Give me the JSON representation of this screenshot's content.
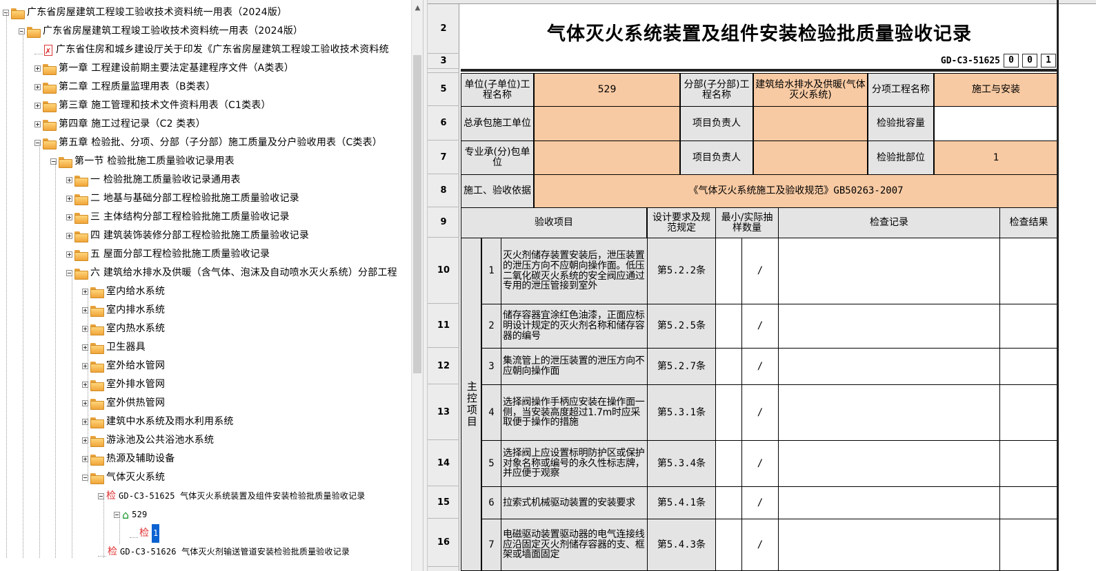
{
  "tree": {
    "nodes": [
      {
        "id": "root",
        "depth": 0,
        "icon": "folder-icon",
        "toggle": "minus",
        "label": "广东省房屋建筑工程竣工验收技术资料统一用表（2024版）"
      },
      {
        "id": "root2",
        "depth": 1,
        "icon": "folder-icon",
        "toggle": "minus",
        "label": "广东省房屋建筑工程竣工验收技术资料统一用表（2024版）"
      },
      {
        "id": "notice",
        "depth": 2,
        "icon": "pdf-icon",
        "toggle": "none",
        "label": "广东省住房和城乡建设厅关于印发《广东省房屋建筑工程竣工验收技术资料统"
      },
      {
        "id": "ch1",
        "depth": 2,
        "icon": "folder-icon",
        "toggle": "plus",
        "label": "第一章 工程建设前期主要法定基建程序文件（A类表）"
      },
      {
        "id": "ch2",
        "depth": 2,
        "icon": "folder-icon",
        "toggle": "plus",
        "label": "第二章 工程质量监理用表（B类表）"
      },
      {
        "id": "ch3",
        "depth": 2,
        "icon": "folder-icon",
        "toggle": "plus",
        "label": "第三章 施工管理和技术文件资料用表（C1类表）"
      },
      {
        "id": "ch4",
        "depth": 2,
        "icon": "folder-icon",
        "toggle": "plus",
        "label": "第四章 施工过程记录（C2 类表）"
      },
      {
        "id": "ch5",
        "depth": 2,
        "icon": "folder-icon",
        "toggle": "minus",
        "label": "第五章 检验批、分项、分部（子分部）施工质量及分户验收用表（C类表）"
      },
      {
        "id": "sec1",
        "depth": 3,
        "icon": "folder-icon",
        "toggle": "minus",
        "label": "第一节 检验批施工质量验收记录用表"
      },
      {
        "id": "s1",
        "depth": 4,
        "icon": "folder-icon",
        "toggle": "plus",
        "label": "一 检验批施工质量验收记录通用表"
      },
      {
        "id": "s2",
        "depth": 4,
        "icon": "folder-icon",
        "toggle": "plus",
        "label": "二 地基与基础分部工程检验批施工质量验收记录"
      },
      {
        "id": "s3",
        "depth": 4,
        "icon": "folder-icon",
        "toggle": "plus",
        "label": "三 主体结构分部工程检验批施工质量验收记录"
      },
      {
        "id": "s4",
        "depth": 4,
        "icon": "folder-icon",
        "toggle": "plus",
        "label": "四 建筑装饰装修分部工程检验批施工质量验收记录"
      },
      {
        "id": "s5",
        "depth": 4,
        "icon": "folder-icon",
        "toggle": "plus",
        "label": "五 屋面分部工程检验批施工质量验收记录"
      },
      {
        "id": "s6",
        "depth": 4,
        "icon": "folder-icon",
        "toggle": "minus",
        "label": "六 建筑给水排水及供暖（含气体、泡沫及自动喷水灭火系统）分部工程"
      },
      {
        "id": "s6a",
        "depth": 5,
        "icon": "folder-icon",
        "toggle": "plus",
        "label": "室内给水系统"
      },
      {
        "id": "s6b",
        "depth": 5,
        "icon": "folder-icon",
        "toggle": "plus",
        "label": "室内排水系统"
      },
      {
        "id": "s6c",
        "depth": 5,
        "icon": "folder-icon",
        "toggle": "plus",
        "label": "室内热水系统"
      },
      {
        "id": "s6d",
        "depth": 5,
        "icon": "folder-icon",
        "toggle": "plus",
        "label": "卫生器具"
      },
      {
        "id": "s6e",
        "depth": 5,
        "icon": "folder-icon",
        "toggle": "plus",
        "label": "室外给水管网"
      },
      {
        "id": "s6f",
        "depth": 5,
        "icon": "folder-icon",
        "toggle": "plus",
        "label": "室外排水管网"
      },
      {
        "id": "s6g",
        "depth": 5,
        "icon": "folder-icon",
        "toggle": "plus",
        "label": "室外供热管网"
      },
      {
        "id": "s6h",
        "depth": 5,
        "icon": "folder-icon",
        "toggle": "plus",
        "label": "建筑中水系统及雨水利用系统"
      },
      {
        "id": "s6i",
        "depth": 5,
        "icon": "folder-icon",
        "toggle": "plus",
        "label": "游泳池及公共浴池水系统"
      },
      {
        "id": "s6j",
        "depth": 5,
        "icon": "folder-icon",
        "toggle": "plus",
        "label": "热源及辅助设备"
      },
      {
        "id": "s6k",
        "depth": 5,
        "icon": "folder-icon",
        "toggle": "minus",
        "label": "气体灭火系统"
      },
      {
        "id": "f1",
        "depth": 6,
        "icon": "check-form-icon",
        "toggle": "minus",
        "label": "GD-C3-51625 气体灭火系统装置及组件安装检验批质量验收记录"
      },
      {
        "id": "f1a",
        "depth": 7,
        "icon": "house-icon",
        "toggle": "minus",
        "label": "529"
      },
      {
        "id": "f1a1",
        "depth": 8,
        "icon": "check-form-icon",
        "toggle": "none",
        "label": "1",
        "selected": true
      },
      {
        "id": "f2",
        "depth": 6,
        "icon": "check-form-icon",
        "toggle": "none",
        "label": "GD-C3-51626 气体灭火剂输送管道安装检验批质量验收记录"
      }
    ],
    "check_glyph": "检"
  },
  "sheet": {
    "row_numbers": [
      "2",
      "3",
      "5",
      "6",
      "7",
      "8",
      "9",
      "10",
      "11",
      "12",
      "13",
      "14",
      "15",
      "16"
    ],
    "title": "气体灭火系统装置及组件安装检验批质量验收记录",
    "doc_no": "GD-C3-51625",
    "doc_boxes": [
      "0",
      "0",
      "1"
    ],
    "r5": {
      "unit_label": "单位(子单位)工程名称",
      "unit_value": "529",
      "dept_label": "分部(子分部)工程名称",
      "dept_value": "建筑给水排水及供暖(气体灭火系统)",
      "sub_label": "分项工程名称",
      "sub_value": "施工与安装"
    },
    "r6": {
      "contractor_label": "总承包施工单位",
      "contractor_value": "",
      "manager_label": "项目负责人",
      "manager_value": "",
      "capacity_label": "检验批容量",
      "capacity_value": ""
    },
    "r7": {
      "sub_contractor_label": "专业承(分)包单位",
      "sub_contractor_value": "",
      "manager_label": "项目负责人",
      "manager_value": "",
      "part_label": "检验批部位",
      "part_value": "1"
    },
    "r8": {
      "basis_label": "施工、验收依据",
      "basis_value": "《气体灭火系统施工及验收规范》GB50263-2007"
    },
    "header": {
      "item": "验收项目",
      "spec": "设计要求及规范规定",
      "sample": "最小/实际抽样数量",
      "record": "检查记录",
      "result": "检查结果"
    },
    "group_label": "主控项目",
    "items": [
      {
        "no": "1",
        "text": "灭火剂储存装置安装后，泄压装置的泄压方向不应朝向操作面。低压二氧化碳灭火系统的安全阀应通过专用的泄压管接到室外",
        "spec": "第5.2.2条",
        "slash": "/"
      },
      {
        "no": "2",
        "text": "储存容器宜涂红色油漆，正面应标明设计规定的灭火剂名称和储存容器的编号",
        "spec": "第5.2.5条",
        "slash": "/"
      },
      {
        "no": "3",
        "text": "集流管上的泄压装置的泄压方向不应朝向操作面",
        "spec": "第5.2.7条",
        "slash": "/"
      },
      {
        "no": "4",
        "text": "选择阀操作手柄应安装在操作面一侧，当安装高度超过1.7m时应采取便于操作的措施",
        "spec": "第5.3.1条",
        "slash": "/"
      },
      {
        "no": "5",
        "text": "选择阀上应设置标明防护区或保护对象名称或编号的永久性标志牌，并应便于观察",
        "spec": "第5.3.4条",
        "slash": "/"
      },
      {
        "no": "6",
        "text": "拉索式机械驱动装置的安装要求",
        "spec": "第5.4.1条",
        "slash": "/"
      },
      {
        "no": "7",
        "text": "电磁驱动装置驱动器的电气连接线应沿固定灭火剂储存容器的支、框架或墙面固定",
        "spec": "第5.4.3条",
        "slash": "/"
      }
    ]
  }
}
